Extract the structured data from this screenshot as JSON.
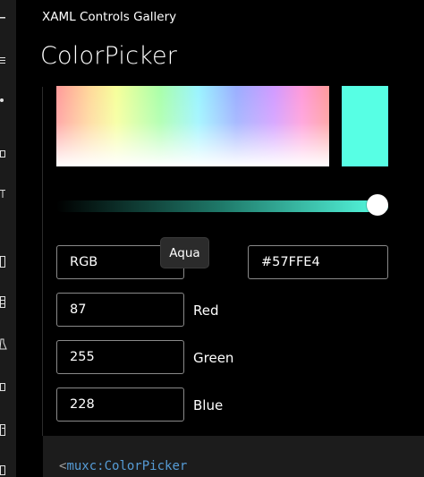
{
  "app": {
    "title": "XAML Controls Gallery"
  },
  "page": {
    "title": "ColorPicker"
  },
  "nav": {
    "icons": [
      "dash-icon",
      "menu-icon",
      "dot-icon",
      "square-icon",
      "tool-icon",
      "frame-icon",
      "grid-icon",
      "flask-icon",
      "box-icon",
      "list-icon",
      "doc-icon"
    ]
  },
  "colors": {
    "selected": "#57FFE4",
    "rail": "#1b1b1b",
    "code_bracket": "#a0a0a0",
    "code_tag": "#569cd6"
  },
  "picker": {
    "value_slider": 1.0,
    "tooltip": "Aqua",
    "mode": {
      "selected": "RGB"
    },
    "hex": "#57FFE4",
    "channels": [
      {
        "label": "Red",
        "value": "87"
      },
      {
        "label": "Green",
        "value": "255"
      },
      {
        "label": "Blue",
        "value": "228"
      }
    ]
  },
  "code": {
    "open": "<",
    "tag": "muxc:ColorPicker"
  }
}
